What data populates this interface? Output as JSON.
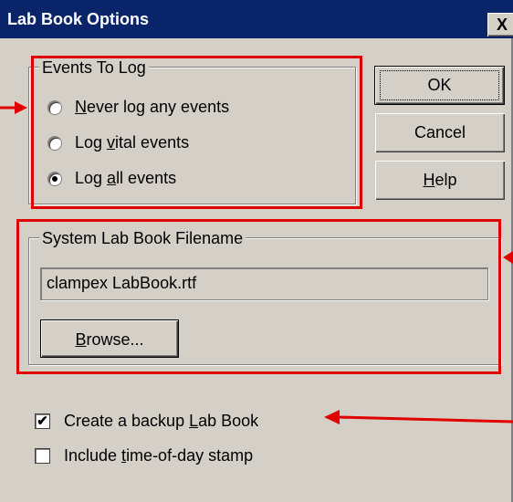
{
  "window": {
    "title": "Lab Book Options",
    "close_label": "X"
  },
  "events_group": {
    "legend": "Events To Log",
    "options": [
      {
        "pre": "",
        "accel": "N",
        "post": "ever log any events",
        "selected": false
      },
      {
        "pre": "Log ",
        "accel": "v",
        "post": "ital events",
        "selected": false
      },
      {
        "pre": "Log ",
        "accel": "a",
        "post": "ll events",
        "selected": true
      }
    ]
  },
  "buttons": {
    "ok": "OK",
    "cancel": "Cancel",
    "help_accel": "H",
    "help_rest": "elp"
  },
  "filename_group": {
    "legend": "System Lab Book Filename",
    "value": "clampex LabBook.rtf",
    "browse_accel": "B",
    "browse_rest": "rowse..."
  },
  "checkboxes": [
    {
      "pre": "Create a backup ",
      "accel": "L",
      "post": "ab Book",
      "checked": true
    },
    {
      "pre": "Include ",
      "accel": "t",
      "post": "ime-of-day stamp",
      "checked": false
    }
  ],
  "colors": {
    "annotation": "#e00000",
    "titlebar": "#0a246a",
    "dialog_face": "#d4d0c8"
  }
}
